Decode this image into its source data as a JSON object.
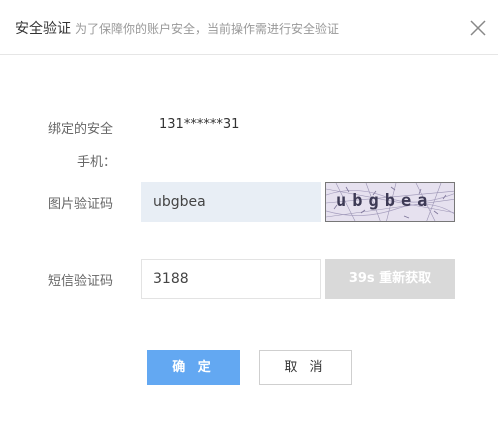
{
  "dialog": {
    "title": "安全验证",
    "subtitle": "为了保障你的账户安全，当前操作需进行安全验证"
  },
  "form": {
    "phone_label_line1": "绑定的安全",
    "phone_label_line2": "手机：",
    "phone_value": "131******31",
    "captcha_label": "图片验证码",
    "captcha_input": "ubgbea",
    "captcha_image_text": "ubgbea",
    "sms_label": "短信验证码",
    "sms_input": "3188",
    "sms_button": "39s 重新获取"
  },
  "actions": {
    "confirm": "确 定",
    "cancel": "取 消"
  },
  "colors": {
    "primary": "#63a8f2",
    "disabled": "#d9d9d9",
    "input_fill": "#e8eef5"
  },
  "icons": {
    "close": "close-icon"
  }
}
